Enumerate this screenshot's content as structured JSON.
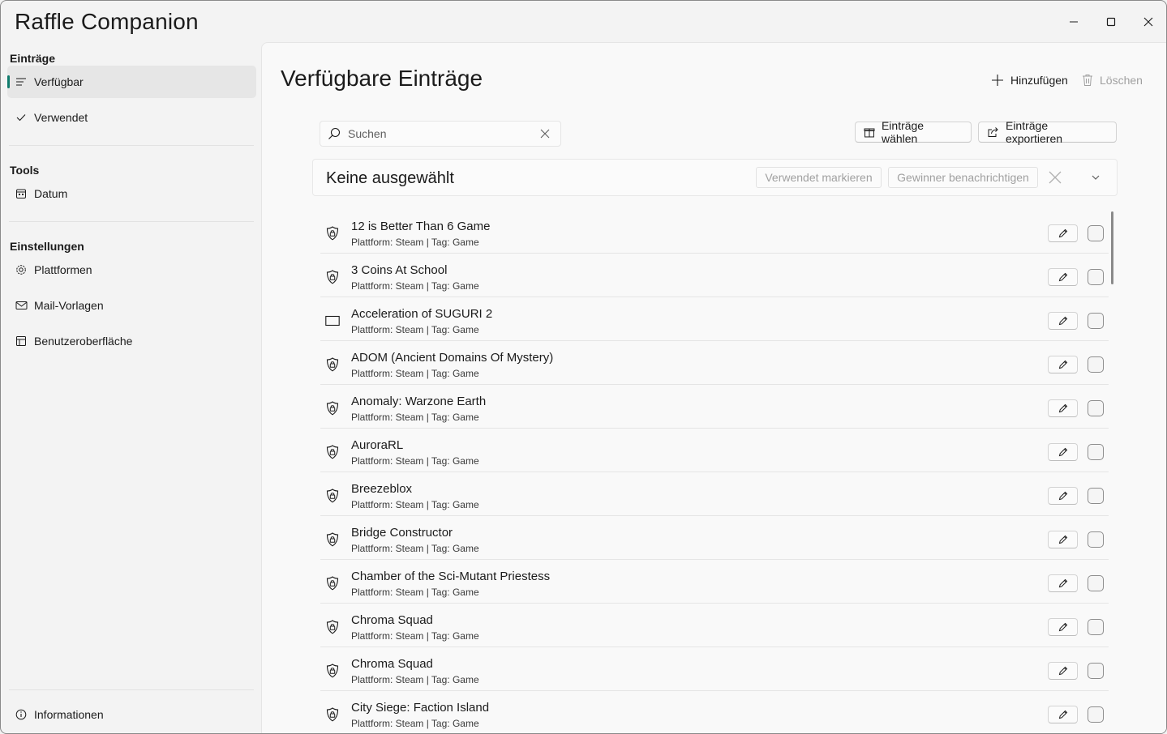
{
  "app": {
    "title": "Raffle Companion"
  },
  "sidebar": {
    "sections": [
      {
        "head": "Einträge"
      },
      {
        "head": "Tools"
      },
      {
        "head": "Einstellungen"
      }
    ],
    "items": [
      {
        "label": "Verfügbar",
        "icon": "list-icon",
        "selected": true
      },
      {
        "label": "Verwendet",
        "icon": "check-icon"
      },
      {
        "label": "Datum",
        "icon": "calendar-icon"
      },
      {
        "label": "Plattformen",
        "icon": "gear-icon"
      },
      {
        "label": "Mail-Vorlagen",
        "icon": "mail-icon"
      },
      {
        "label": "Benutzeroberfläche",
        "icon": "ui-layout-icon"
      },
      {
        "label": "Informationen",
        "icon": "info-icon"
      }
    ]
  },
  "main": {
    "title": "Verfügbare Einträge",
    "add_label": "Hinzufügen",
    "delete_label": "Löschen",
    "search_placeholder": "Suchen",
    "choose_label": "Einträge wählen",
    "export_label": "Einträge exportieren",
    "selection_title": "Keine ausgewählt",
    "mark_used_label": "Verwendet markieren",
    "notify_label": "Gewinner benachrichtigen"
  },
  "entries": [
    {
      "title": "12 is Better Than 6 Game",
      "subtitle": "Plattform: Steam | Tag: Game",
      "icon": "shield-lock-icon"
    },
    {
      "title": "3 Coins At School",
      "subtitle": "Plattform: Steam | Tag: Game",
      "icon": "shield-lock-icon"
    },
    {
      "title": "Acceleration of SUGURI 2",
      "subtitle": "Plattform: Steam | Tag: Game",
      "icon": "rectangle-icon"
    },
    {
      "title": "ADOM (Ancient Domains Of Mystery)",
      "subtitle": "Plattform: Steam | Tag: Game",
      "icon": "shield-lock-icon"
    },
    {
      "title": "Anomaly: Warzone Earth",
      "subtitle": "Plattform: Steam | Tag: Game",
      "icon": "shield-lock-icon"
    },
    {
      "title": "AuroraRL",
      "subtitle": "Plattform: Steam | Tag: Game",
      "icon": "shield-lock-icon"
    },
    {
      "title": "Breezeblox",
      "subtitle": "Plattform: Steam | Tag: Game",
      "icon": "shield-lock-icon"
    },
    {
      "title": "Bridge Constructor",
      "subtitle": "Plattform: Steam | Tag: Game",
      "icon": "shield-lock-icon"
    },
    {
      "title": "Chamber of the Sci-Mutant Priestess",
      "subtitle": "Plattform: Steam | Tag: Game",
      "icon": "shield-lock-icon"
    },
    {
      "title": "Chroma Squad",
      "subtitle": "Plattform: Steam | Tag: Game",
      "icon": "shield-lock-icon"
    },
    {
      "title": "Chroma Squad",
      "subtitle": "Plattform: Steam | Tag: Game",
      "icon": "shield-lock-icon"
    },
    {
      "title": "City Siege: Faction Island",
      "subtitle": "Plattform: Steam | Tag: Game",
      "icon": "shield-lock-icon"
    }
  ]
}
